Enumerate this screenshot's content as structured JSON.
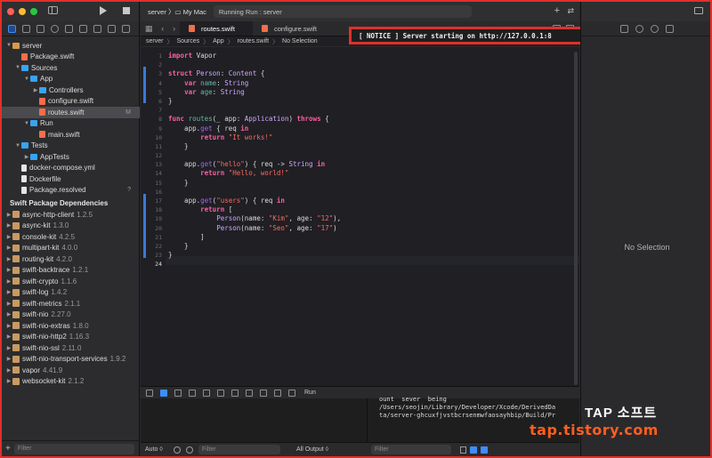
{
  "toolbar": {
    "scheme_target": "server",
    "scheme_device": "My Mac",
    "status": "Running Run : server"
  },
  "navigator": {
    "tree": [
      {
        "label": "server",
        "depth": 0,
        "icon": "project",
        "open": true
      },
      {
        "label": "Package.swift",
        "depth": 1,
        "icon": "swift"
      },
      {
        "label": "Sources",
        "depth": 1,
        "icon": "folder",
        "open": true
      },
      {
        "label": "App",
        "depth": 2,
        "icon": "folder",
        "open": true
      },
      {
        "label": "Controllers",
        "depth": 3,
        "icon": "folder",
        "open": false
      },
      {
        "label": "configure.swift",
        "depth": 3,
        "icon": "swift"
      },
      {
        "label": "routes.swift",
        "depth": 3,
        "icon": "swift",
        "selected": true,
        "badge": "M"
      },
      {
        "label": "Run",
        "depth": 2,
        "icon": "folder",
        "open": true
      },
      {
        "label": "main.swift",
        "depth": 3,
        "icon": "swift"
      },
      {
        "label": "Tests",
        "depth": 1,
        "icon": "folder",
        "open": true
      },
      {
        "label": "AppTests",
        "depth": 2,
        "icon": "folder",
        "open": false
      },
      {
        "label": "docker-compose.yml",
        "depth": 1,
        "icon": "file"
      },
      {
        "label": "Dockerfile",
        "depth": 1,
        "icon": "file"
      },
      {
        "label": "Package.resolved",
        "depth": 1,
        "icon": "file",
        "badge": "?"
      }
    ],
    "deps_header": "Swift Package Dependencies",
    "dependencies": [
      {
        "name": "async-http-client",
        "version": "1.2.5"
      },
      {
        "name": "async-kit",
        "version": "1.3.0"
      },
      {
        "name": "console-kit",
        "version": "4.2.5"
      },
      {
        "name": "multipart-kit",
        "version": "4.0.0"
      },
      {
        "name": "routing-kit",
        "version": "4.2.0"
      },
      {
        "name": "swift-backtrace",
        "version": "1.2.1"
      },
      {
        "name": "swift-crypto",
        "version": "1.1.6"
      },
      {
        "name": "swift-log",
        "version": "1.4.2"
      },
      {
        "name": "swift-metrics",
        "version": "2.1.1"
      },
      {
        "name": "swift-nio",
        "version": "2.27.0"
      },
      {
        "name": "swift-nio-extras",
        "version": "1.8.0"
      },
      {
        "name": "swift-nio-http2",
        "version": "1.16.3"
      },
      {
        "name": "swift-nio-ssl",
        "version": "2.11.0"
      },
      {
        "name": "swift-nio-transport-services",
        "version": "1.9.2"
      },
      {
        "name": "vapor",
        "version": "4.41.9"
      },
      {
        "name": "websocket-kit",
        "version": "2.1.2"
      }
    ],
    "filter_placeholder": "Filter"
  },
  "tabs": [
    {
      "label": "routes.swift",
      "active": true
    },
    {
      "label": "configure.swift",
      "active": false
    }
  ],
  "jumpbar": [
    "server",
    "Sources",
    "App",
    "routes.swift",
    "No Selection"
  ],
  "editor": {
    "current_line": 24,
    "lines": [
      [
        [
          "k",
          "import"
        ],
        [
          "x",
          " Vapor"
        ]
      ],
      [],
      [
        [
          "k",
          "struct"
        ],
        [
          "x",
          " "
        ],
        [
          "t",
          "Person"
        ],
        [
          "x",
          ": "
        ],
        [
          "t",
          "Content"
        ],
        [
          "x",
          " {"
        ]
      ],
      [
        [
          "x",
          "    "
        ],
        [
          "k",
          "var"
        ],
        [
          "x",
          " "
        ],
        [
          "p",
          "name"
        ],
        [
          "x",
          ": "
        ],
        [
          "t",
          "String"
        ]
      ],
      [
        [
          "x",
          "    "
        ],
        [
          "k",
          "var"
        ],
        [
          "x",
          " "
        ],
        [
          "p",
          "age"
        ],
        [
          "x",
          ": "
        ],
        [
          "t",
          "String"
        ]
      ],
      [
        [
          "x",
          "}"
        ]
      ],
      [],
      [
        [
          "k",
          "func"
        ],
        [
          "x",
          " "
        ],
        [
          "p",
          "routes"
        ],
        [
          "x",
          "(_ app: "
        ],
        [
          "t",
          "Application"
        ],
        [
          "x",
          ") "
        ],
        [
          "k",
          "throws"
        ],
        [
          "x",
          " {"
        ]
      ],
      [
        [
          "x",
          "    app."
        ],
        [
          "f",
          "get"
        ],
        [
          "x",
          " { req "
        ],
        [
          "k",
          "in"
        ]
      ],
      [
        [
          "x",
          "        "
        ],
        [
          "k",
          "return"
        ],
        [
          "x",
          " "
        ],
        [
          "s",
          "\"It works!\""
        ]
      ],
      [
        [
          "x",
          "    }"
        ]
      ],
      [],
      [
        [
          "x",
          "    app."
        ],
        [
          "f",
          "get"
        ],
        [
          "x",
          "("
        ],
        [
          "s",
          "\"hello\""
        ],
        [
          "x",
          ") { req -> "
        ],
        [
          "t",
          "String"
        ],
        [
          "x",
          " "
        ],
        [
          "k",
          "in"
        ]
      ],
      [
        [
          "x",
          "        "
        ],
        [
          "k",
          "return"
        ],
        [
          "x",
          " "
        ],
        [
          "s",
          "\"Hello, world!\""
        ]
      ],
      [
        [
          "x",
          "    }"
        ]
      ],
      [],
      [
        [
          "x",
          "    app."
        ],
        [
          "f",
          "get"
        ],
        [
          "x",
          "("
        ],
        [
          "s",
          "\"users\""
        ],
        [
          "x",
          ") { req "
        ],
        [
          "k",
          "in"
        ]
      ],
      [
        [
          "x",
          "        "
        ],
        [
          "k",
          "return"
        ],
        [
          "x",
          " ["
        ]
      ],
      [
        [
          "x",
          "            "
        ],
        [
          "t",
          "Person"
        ],
        [
          "x",
          "(name: "
        ],
        [
          "s",
          "\"Kim\""
        ],
        [
          "x",
          ", age: "
        ],
        [
          "s",
          "\"12\""
        ],
        [
          "x",
          "),"
        ]
      ],
      [
        [
          "x",
          "            "
        ],
        [
          "t",
          "Person"
        ],
        [
          "x",
          "(name: "
        ],
        [
          "s",
          "\"Seo\""
        ],
        [
          "x",
          ", age: "
        ],
        [
          "s",
          "\"17\""
        ],
        [
          "x",
          ")"
        ]
      ],
      [
        [
          "x",
          "        ]"
        ]
      ],
      [
        [
          "x",
          "    }"
        ]
      ],
      [
        [
          "x",
          "}"
        ]
      ],
      []
    ]
  },
  "debug": {
    "run_label": "Run"
  },
  "console": {
    "lines": [
      "ount  sever  being",
      "/Users/seojin/Library/Developer/Xcode/DerivedDa",
      "ta/server-ghcuxfjvstbcrsenmwfaosayhbip/Build/Pr"
    ],
    "notice": "[ NOTICE ] Server starting on http://127.0.0.1:8"
  },
  "console_footer": {
    "auto_label": "Auto ◊",
    "filter_placeholder": "Filter",
    "output_label": "All Output ◊",
    "filter2_placeholder": "Filter"
  },
  "inspector": {
    "empty_label": "No Selection"
  },
  "watermark": {
    "title": "TAP 소프트",
    "url": "tap.tistory.com"
  }
}
